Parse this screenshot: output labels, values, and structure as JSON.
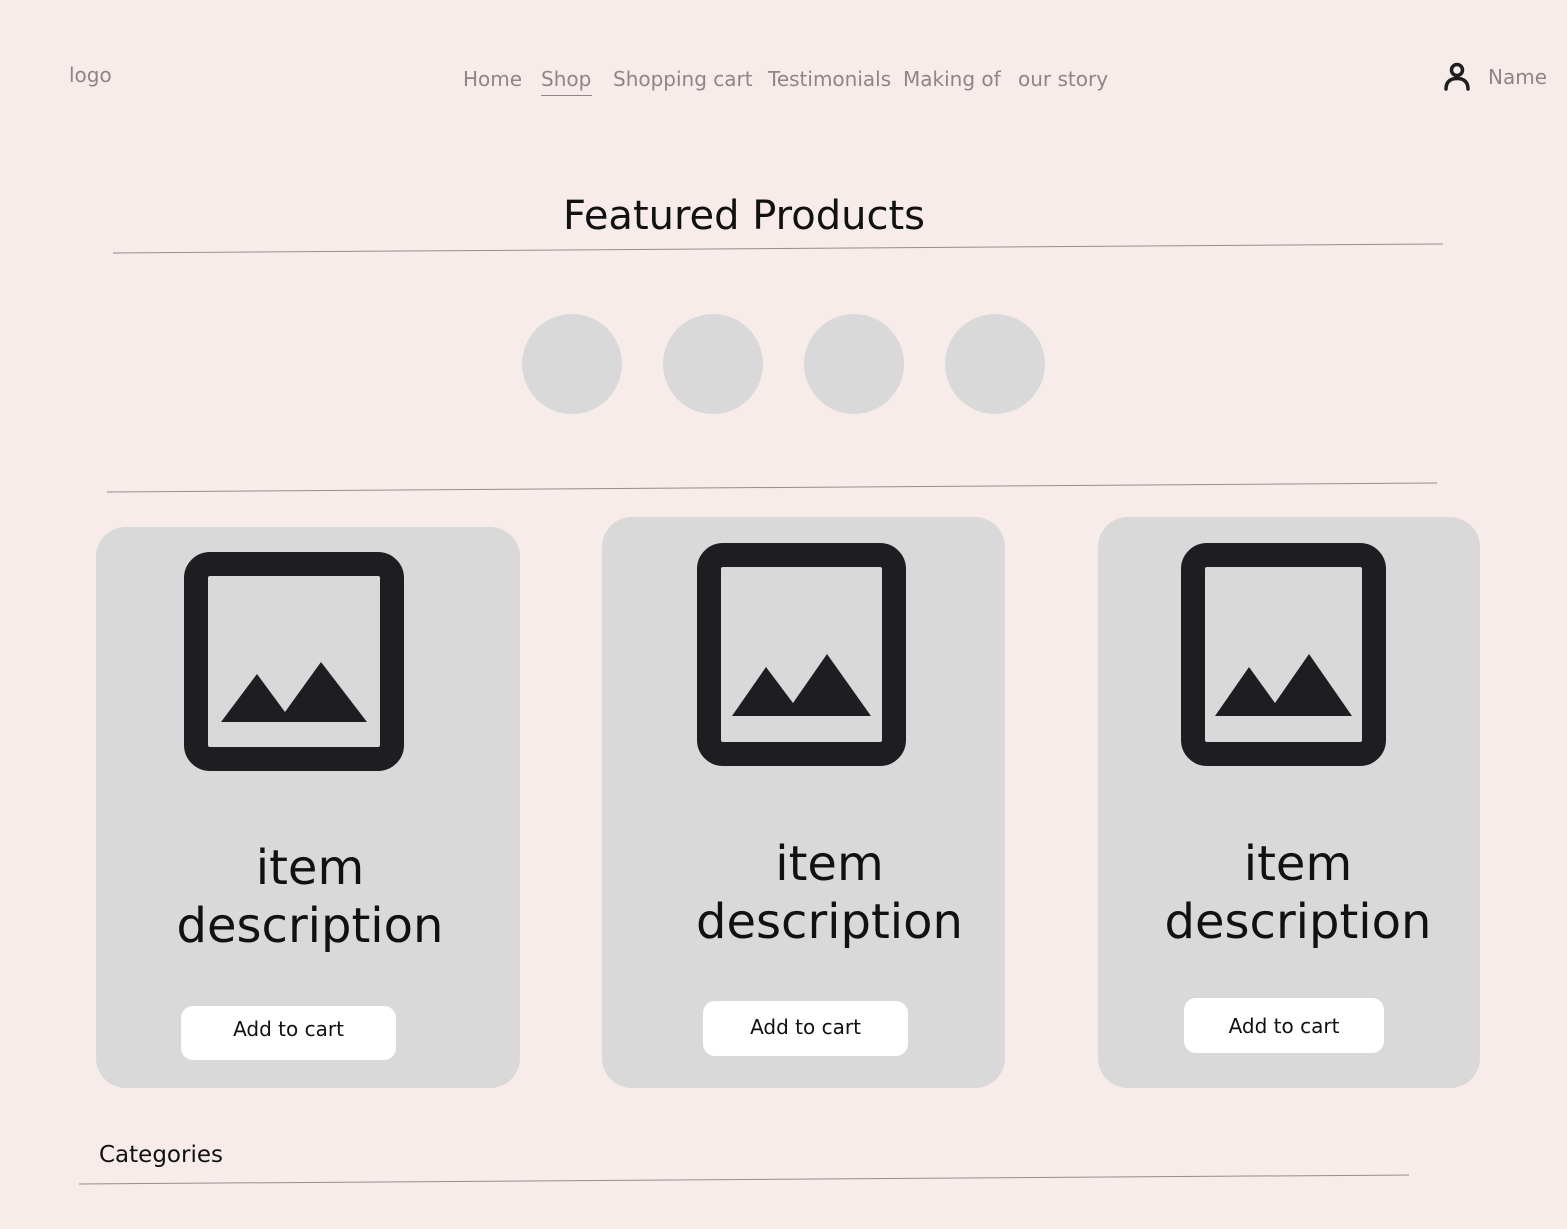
{
  "header": {
    "logo": "logo",
    "nav": [
      {
        "label": "Home"
      },
      {
        "label": "Shop"
      },
      {
        "label": "Shopping cart"
      },
      {
        "label": "Testimonials"
      },
      {
        "label": "Making of"
      },
      {
        "label": "our story"
      }
    ],
    "active_nav": "Shop",
    "user": {
      "icon": "user-icon",
      "name": "Name"
    }
  },
  "featured": {
    "title": "Featured Products",
    "carousel_dots": 4
  },
  "products": [
    {
      "image_icon": "image-placeholder-icon",
      "description": "item description",
      "button_label": "Add to cart"
    },
    {
      "image_icon": "image-placeholder-icon",
      "description": "item description",
      "button_label": "Add to cart"
    },
    {
      "image_icon": "image-placeholder-icon",
      "description": "item description",
      "button_label": "Add to cart"
    }
  ],
  "categories": {
    "label": "Categories"
  },
  "colors": {
    "background": "#f7ecea",
    "card": "#d9d9d9",
    "nav_text": "#8e8587",
    "icon": "#1e1d21",
    "rule": "#9a8a8c"
  }
}
